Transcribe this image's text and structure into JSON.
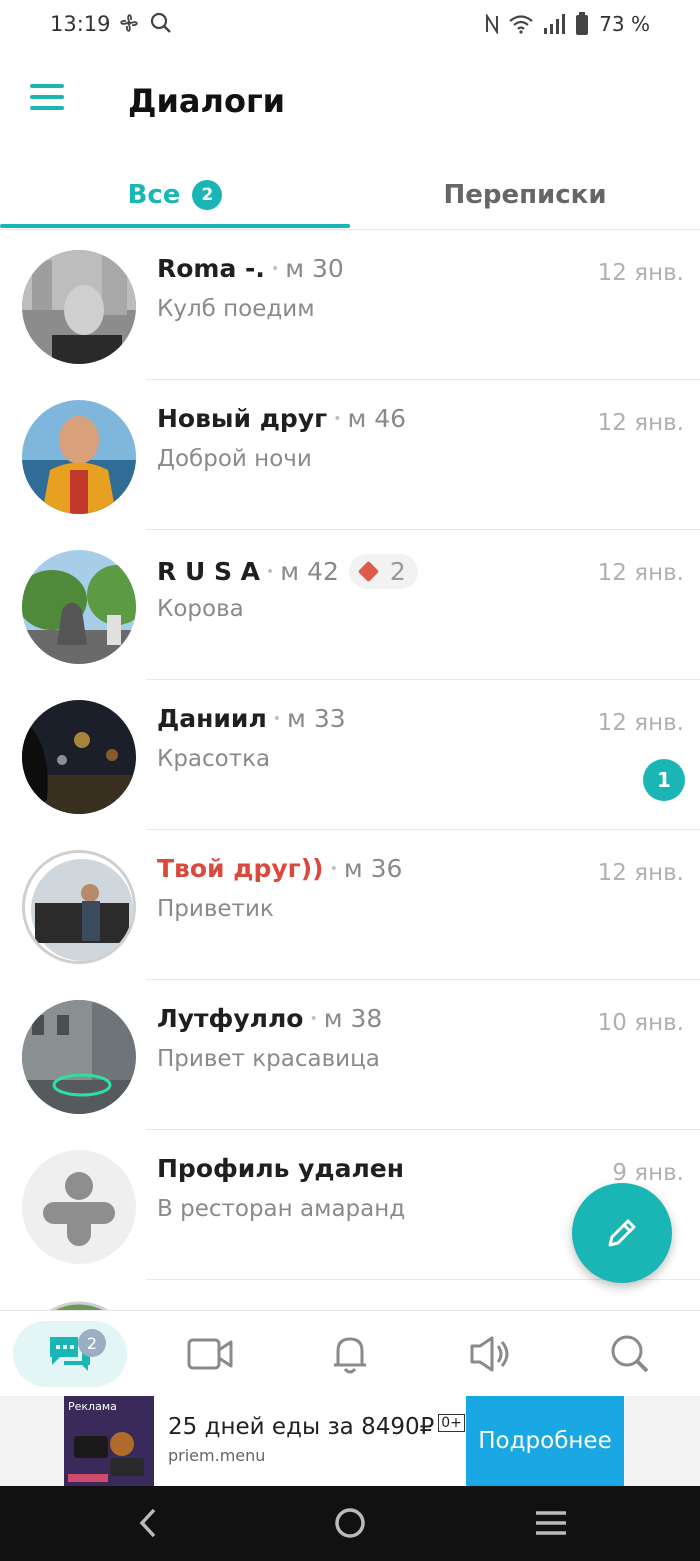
{
  "status_bar": {
    "time": "13:19",
    "battery": "73 %",
    "icons": [
      "fan-icon",
      "search-icon",
      "nfc-icon",
      "wifi-icon",
      "signal-icon",
      "battery-icon"
    ]
  },
  "header": {
    "title": "Диалоги",
    "menu_icon": "hamburger-icon"
  },
  "tabs": [
    {
      "label": "Все",
      "badge": "2",
      "active": true
    },
    {
      "label": "Переписки",
      "active": false
    }
  ],
  "dialogs": [
    {
      "name": "Roma -.",
      "meta": "м 30",
      "message": "Кулб поедим",
      "date": "12 янв."
    },
    {
      "name": "Новый друг",
      "meta": "м 46",
      "message": "Доброй ночи",
      "date": "12 янв."
    },
    {
      "name": "R U S A",
      "meta": "м 42",
      "gift_count": "2",
      "message": "Корова",
      "date": "12 янв."
    },
    {
      "name": "Даниил",
      "meta": "м 33",
      "message": "Красотка",
      "date": "12 янв.",
      "unread": "1"
    },
    {
      "name": "Твой друг))",
      "meta": "м 36",
      "message": "Приветик",
      "date": "12 янв.",
      "highlight_color": "#d9493c"
    },
    {
      "name": "Лутфулло",
      "meta": "м 38",
      "message": "Привет красавица",
      "date": "10 янв."
    },
    {
      "name": "Профиль удален",
      "meta": "",
      "message": "В ресторан амаранд",
      "date": "9 янв."
    }
  ],
  "fab": {
    "icon": "pencil-icon"
  },
  "bottom_nav": [
    {
      "icon": "chat-icon",
      "badge": "2",
      "active": true
    },
    {
      "icon": "video-icon"
    },
    {
      "icon": "bell-icon"
    },
    {
      "icon": "speaker-icon"
    },
    {
      "icon": "search-icon"
    }
  ],
  "ad": {
    "label": "Реклама",
    "title": "25 дней еды за 8490₽",
    "age": "0+",
    "url": "priem.menu",
    "button": "Подробнее"
  },
  "colors": {
    "accent": "#1ab5b5",
    "red_name": "#d9493c",
    "ad_button": "#1aa8e4"
  }
}
